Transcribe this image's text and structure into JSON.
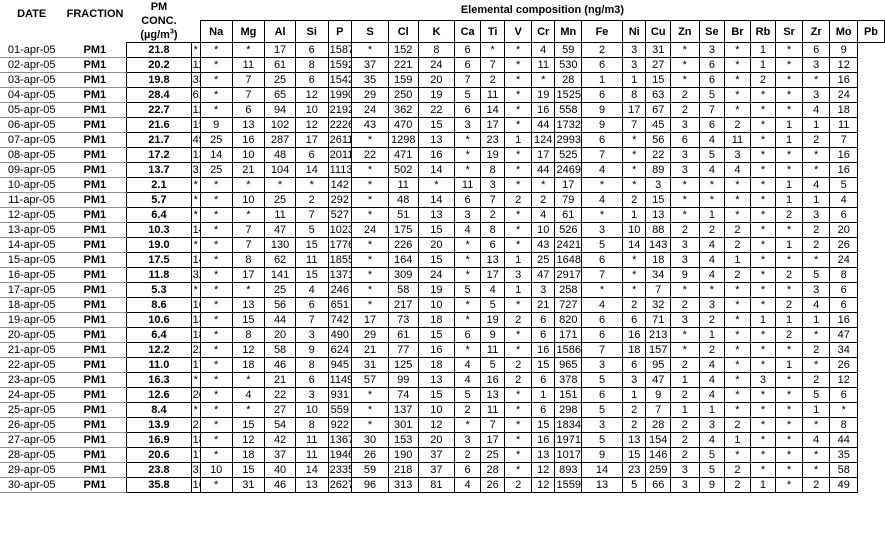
{
  "headers": {
    "date": "DATE",
    "fraction": "FRACTION",
    "pm_line1": "PM",
    "pm_line2": "CONC.",
    "pm_unit_prefix": "(µg/m",
    "pm_unit_exp": "3",
    "pm_unit_suffix": ")",
    "elemental_title": "Elemental composition (ng/m3)",
    "elements": [
      "Na",
      "Mg",
      "Al",
      "Si",
      "P",
      "S",
      "Cl",
      "K",
      "Ca",
      "Ti",
      "V",
      "Cr",
      "Mn",
      "Fe",
      "Ni",
      "Cu",
      "Zn",
      "Se",
      "Br",
      "Rb",
      "Sr",
      "Zr",
      "Mo",
      "Pb"
    ]
  },
  "rows": [
    {
      "date": "01-apr-05",
      "fraction": "PM1",
      "pm": "21.8",
      "values": [
        "*",
        "*",
        "*",
        "17",
        "6",
        "1587",
        "*",
        "152",
        "8",
        "6",
        "*",
        "*",
        "4",
        "59",
        "2",
        "3",
        "31",
        "*",
        "3",
        "*",
        "1",
        "*",
        "6",
        "9"
      ]
    },
    {
      "date": "02-apr-05",
      "fraction": "PM1",
      "pm": "20.2",
      "values": [
        "118",
        "*",
        "11",
        "61",
        "8",
        "1592",
        "37",
        "221",
        "24",
        "6",
        "7",
        "*",
        "11",
        "530",
        "6",
        "3",
        "27",
        "*",
        "6",
        "*",
        "1",
        "*",
        "3",
        "12"
      ]
    },
    {
      "date": "03-apr-05",
      "fraction": "PM1",
      "pm": "19.8",
      "values": [
        "33",
        "*",
        "7",
        "25",
        "6",
        "1542",
        "35",
        "159",
        "20",
        "7",
        "2",
        "*",
        "*",
        "28",
        "1",
        "1",
        "15",
        "*",
        "6",
        "*",
        "2",
        "*",
        "*",
        "16"
      ]
    },
    {
      "date": "04-apr-05",
      "fraction": "PM1",
      "pm": "28.4",
      "values": [
        "61",
        "*",
        "7",
        "65",
        "12",
        "1990",
        "29",
        "250",
        "19",
        "5",
        "11",
        "*",
        "19",
        "1525",
        "6",
        "8",
        "63",
        "2",
        "5",
        "*",
        "*",
        "*",
        "3",
        "24"
      ]
    },
    {
      "date": "05-apr-05",
      "fraction": "PM1",
      "pm": "22.7",
      "values": [
        "126",
        "*",
        "6",
        "94",
        "10",
        "2192",
        "24",
        "362",
        "22",
        "6",
        "14",
        "*",
        "16",
        "558",
        "9",
        "17",
        "67",
        "2",
        "7",
        "*",
        "*",
        "*",
        "4",
        "18"
      ]
    },
    {
      "date": "06-apr-05",
      "fraction": "PM1",
      "pm": "21.6",
      "values": [
        "158",
        "9",
        "13",
        "102",
        "12",
        "2226",
        "43",
        "470",
        "15",
        "3",
        "17",
        "*",
        "44",
        "1732",
        "9",
        "7",
        "45",
        "3",
        "6",
        "2",
        "*",
        "1",
        "1",
        "11"
      ]
    },
    {
      "date": "07-apr-05",
      "fraction": "PM1",
      "pm": "21.7",
      "values": [
        "453",
        "25",
        "16",
        "287",
        "17",
        "2611",
        "*",
        "1298",
        "13",
        "*",
        "23",
        "1",
        "124",
        "2993",
        "6",
        "*",
        "56",
        "6",
        "4",
        "11",
        "*",
        "1",
        "2",
        "7"
      ]
    },
    {
      "date": "08-apr-05",
      "fraction": "PM1",
      "pm": "17.2",
      "values": [
        "131",
        "14",
        "10",
        "48",
        "6",
        "2011",
        "22",
        "471",
        "16",
        "*",
        "19",
        "*",
        "17",
        "525",
        "7",
        "*",
        "22",
        "3",
        "5",
        "3",
        "*",
        "*",
        "*",
        "16"
      ]
    },
    {
      "date": "09-apr-05",
      "fraction": "PM1",
      "pm": "13.7",
      "values": [
        "319",
        "25",
        "21",
        "104",
        "14",
        "1113",
        "*",
        "502",
        "14",
        "*",
        "8",
        "*",
        "44",
        "2469",
        "4",
        "*",
        "89",
        "3",
        "4",
        "4",
        "*",
        "*",
        "*",
        "16"
      ]
    },
    {
      "date": "10-apr-05",
      "fraction": "PM1",
      "pm": "2.1",
      "values": [
        "*",
        "*",
        "*",
        "*",
        "*",
        "142",
        "*",
        "11",
        "*",
        "11",
        "3",
        "*",
        "*",
        "17",
        "*",
        "*",
        "3",
        "*",
        "*",
        "*",
        "*",
        "1",
        "4",
        "5"
      ]
    },
    {
      "date": "11-apr-05",
      "fraction": "PM1",
      "pm": "5.7",
      "values": [
        "*",
        "*",
        "10",
        "25",
        "2",
        "292",
        "*",
        "48",
        "14",
        "6",
        "7",
        "2",
        "2",
        "79",
        "4",
        "2",
        "15",
        "*",
        "*",
        "*",
        "*",
        "1",
        "1",
        "4"
      ]
    },
    {
      "date": "12-apr-05",
      "fraction": "PM1",
      "pm": "6.4",
      "values": [
        "*",
        "*",
        "*",
        "11",
        "7",
        "527",
        "*",
        "51",
        "13",
        "3",
        "2",
        "*",
        "4",
        "61",
        "*",
        "1",
        "13",
        "*",
        "1",
        "*",
        "*",
        "2",
        "3",
        "6"
      ]
    },
    {
      "date": "13-apr-05",
      "fraction": "PM1",
      "pm": "10.3",
      "values": [
        "145",
        "*",
        "7",
        "47",
        "5",
        "1023",
        "24",
        "175",
        "15",
        "4",
        "8",
        "*",
        "10",
        "526",
        "3",
        "10",
        "88",
        "2",
        "2",
        "2",
        "*",
        "*",
        "2",
        "20"
      ]
    },
    {
      "date": "14-apr-05",
      "fraction": "PM1",
      "pm": "19.0",
      "values": [
        "*",
        "*",
        "7",
        "130",
        "15",
        "1776",
        "*",
        "226",
        "20",
        "*",
        "6",
        "*",
        "43",
        "2421",
        "5",
        "14",
        "143",
        "3",
        "4",
        "2",
        "*",
        "1",
        "2",
        "26"
      ]
    },
    {
      "date": "15-apr-05",
      "fraction": "PM1",
      "pm": "17.5",
      "values": [
        "147",
        "*",
        "8",
        "62",
        "11",
        "1855",
        "*",
        "164",
        "15",
        "*",
        "13",
        "1",
        "25",
        "1648",
        "6",
        "*",
        "18",
        "3",
        "4",
        "1",
        "*",
        "*",
        "*",
        "24"
      ]
    },
    {
      "date": "16-apr-05",
      "fraction": "PM1",
      "pm": "11.8",
      "values": [
        "324",
        "*",
        "17",
        "141",
        "15",
        "1371",
        "*",
        "309",
        "24",
        "*",
        "17",
        "3",
        "47",
        "2917",
        "7",
        "*",
        "34",
        "9",
        "4",
        "2",
        "*",
        "2",
        "5",
        "8"
      ]
    },
    {
      "date": "17-apr-05",
      "fraction": "PM1",
      "pm": "5.3",
      "values": [
        "*",
        "*",
        "*",
        "25",
        "4",
        "246",
        "*",
        "58",
        "19",
        "5",
        "4",
        "1",
        "3",
        "258",
        "*",
        "*",
        "7",
        "*",
        "*",
        "*",
        "*",
        "*",
        "3",
        "6"
      ]
    },
    {
      "date": "18-apr-05",
      "fraction": "PM1",
      "pm": "8.6",
      "values": [
        "169",
        "*",
        "13",
        "56",
        "6",
        "651",
        "*",
        "217",
        "10",
        "*",
        "5",
        "*",
        "21",
        "727",
        "4",
        "2",
        "32",
        "2",
        "3",
        "*",
        "*",
        "2",
        "4",
        "6"
      ]
    },
    {
      "date": "19-apr-05",
      "fraction": "PM1",
      "pm": "10.6",
      "values": [
        "135",
        "*",
        "15",
        "44",
        "7",
        "742",
        "17",
        "73",
        "18",
        "*",
        "19",
        "2",
        "6",
        "820",
        "6",
        "6",
        "71",
        "3",
        "2",
        "*",
        "1",
        "1",
        "1",
        "16"
      ]
    },
    {
      "date": "20-apr-05",
      "fraction": "PM1",
      "pm": "6.4",
      "values": [
        "185",
        "*",
        "8",
        "20",
        "3",
        "490",
        "29",
        "61",
        "15",
        "6",
        "9",
        "*",
        "6",
        "171",
        "6",
        "16",
        "213",
        "*",
        "1",
        "*",
        "*",
        "2",
        "*",
        "47"
      ]
    },
    {
      "date": "21-apr-05",
      "fraction": "PM1",
      "pm": "12.2",
      "values": [
        "223",
        "*",
        "12",
        "58",
        "9",
        "624",
        "21",
        "77",
        "16",
        "*",
        "11",
        "*",
        "16",
        "1586",
        "7",
        "18",
        "157",
        "*",
        "2",
        "*",
        "*",
        "*",
        "2",
        "34"
      ]
    },
    {
      "date": "22-apr-05",
      "fraction": "PM1",
      "pm": "11.0",
      "values": [
        "177",
        "*",
        "18",
        "46",
        "8",
        "945",
        "31",
        "125",
        "18",
        "4",
        "5",
        "2",
        "15",
        "965",
        "3",
        "6",
        "95",
        "2",
        "4",
        "*",
        "*",
        "1",
        "*",
        "26"
      ]
    },
    {
      "date": "23-apr-05",
      "fraction": "PM1",
      "pm": "16.3",
      "values": [
        "*",
        "*",
        "*",
        "21",
        "6",
        "1149",
        "57",
        "99",
        "13",
        "4",
        "16",
        "2",
        "6",
        "378",
        "5",
        "3",
        "47",
        "1",
        "4",
        "*",
        "3",
        "*",
        "2",
        "12"
      ]
    },
    {
      "date": "24-apr-05",
      "fraction": "PM1",
      "pm": "12.6",
      "values": [
        "26",
        "*",
        "4",
        "22",
        "3",
        "931",
        "*",
        "74",
        "15",
        "5",
        "13",
        "*",
        "1",
        "151",
        "6",
        "1",
        "9",
        "2",
        "4",
        "*",
        "*",
        "*",
        "5",
        "6"
      ]
    },
    {
      "date": "25-apr-05",
      "fraction": "PM1",
      "pm": "8.4",
      "values": [
        "*",
        "*",
        "*",
        "27",
        "10",
        "559",
        "*",
        "137",
        "10",
        "2",
        "11",
        "*",
        "6",
        "298",
        "5",
        "2",
        "7",
        "1",
        "1",
        "*",
        "*",
        "*",
        "1",
        "*"
      ]
    },
    {
      "date": "26-apr-05",
      "fraction": "PM1",
      "pm": "13.9",
      "values": [
        "218",
        "*",
        "15",
        "54",
        "8",
        "922",
        "*",
        "301",
        "12",
        "*",
        "7",
        "*",
        "15",
        "1834",
        "3",
        "2",
        "28",
        "2",
        "3",
        "2",
        "*",
        "*",
        "*",
        "8"
      ]
    },
    {
      "date": "27-apr-05",
      "fraction": "PM1",
      "pm": "16.9",
      "values": [
        "180",
        "*",
        "12",
        "42",
        "11",
        "1367",
        "30",
        "153",
        "20",
        "3",
        "17",
        "*",
        "16",
        "1971",
        "5",
        "13",
        "154",
        "2",
        "4",
        "1",
        "*",
        "*",
        "4",
        "44"
      ]
    },
    {
      "date": "28-apr-05",
      "fraction": "PM1",
      "pm": "20.6",
      "values": [
        "179",
        "*",
        "18",
        "37",
        "11",
        "1946",
        "26",
        "190",
        "37",
        "2",
        "25",
        "*",
        "13",
        "1017",
        "9",
        "15",
        "146",
        "2",
        "5",
        "*",
        "*",
        "*",
        "*",
        "35"
      ]
    },
    {
      "date": "29-apr-05",
      "fraction": "PM1",
      "pm": "23.8",
      "values": [
        "311",
        "10",
        "15",
        "40",
        "14",
        "2335",
        "59",
        "218",
        "37",
        "6",
        "28",
        "*",
        "12",
        "893",
        "14",
        "23",
        "259",
        "3",
        "5",
        "2",
        "*",
        "*",
        "*",
        "58"
      ]
    },
    {
      "date": "30-apr-05",
      "fraction": "PM1",
      "pm": "35.8",
      "values": [
        "162",
        "*",
        "31",
        "46",
        "13",
        "2627",
        "96",
        "313",
        "81",
        "4",
        "26",
        "2",
        "12",
        "1559",
        "13",
        "5",
        "66",
        "3",
        "9",
        "2",
        "1",
        "*",
        "2",
        "49"
      ]
    }
  ]
}
